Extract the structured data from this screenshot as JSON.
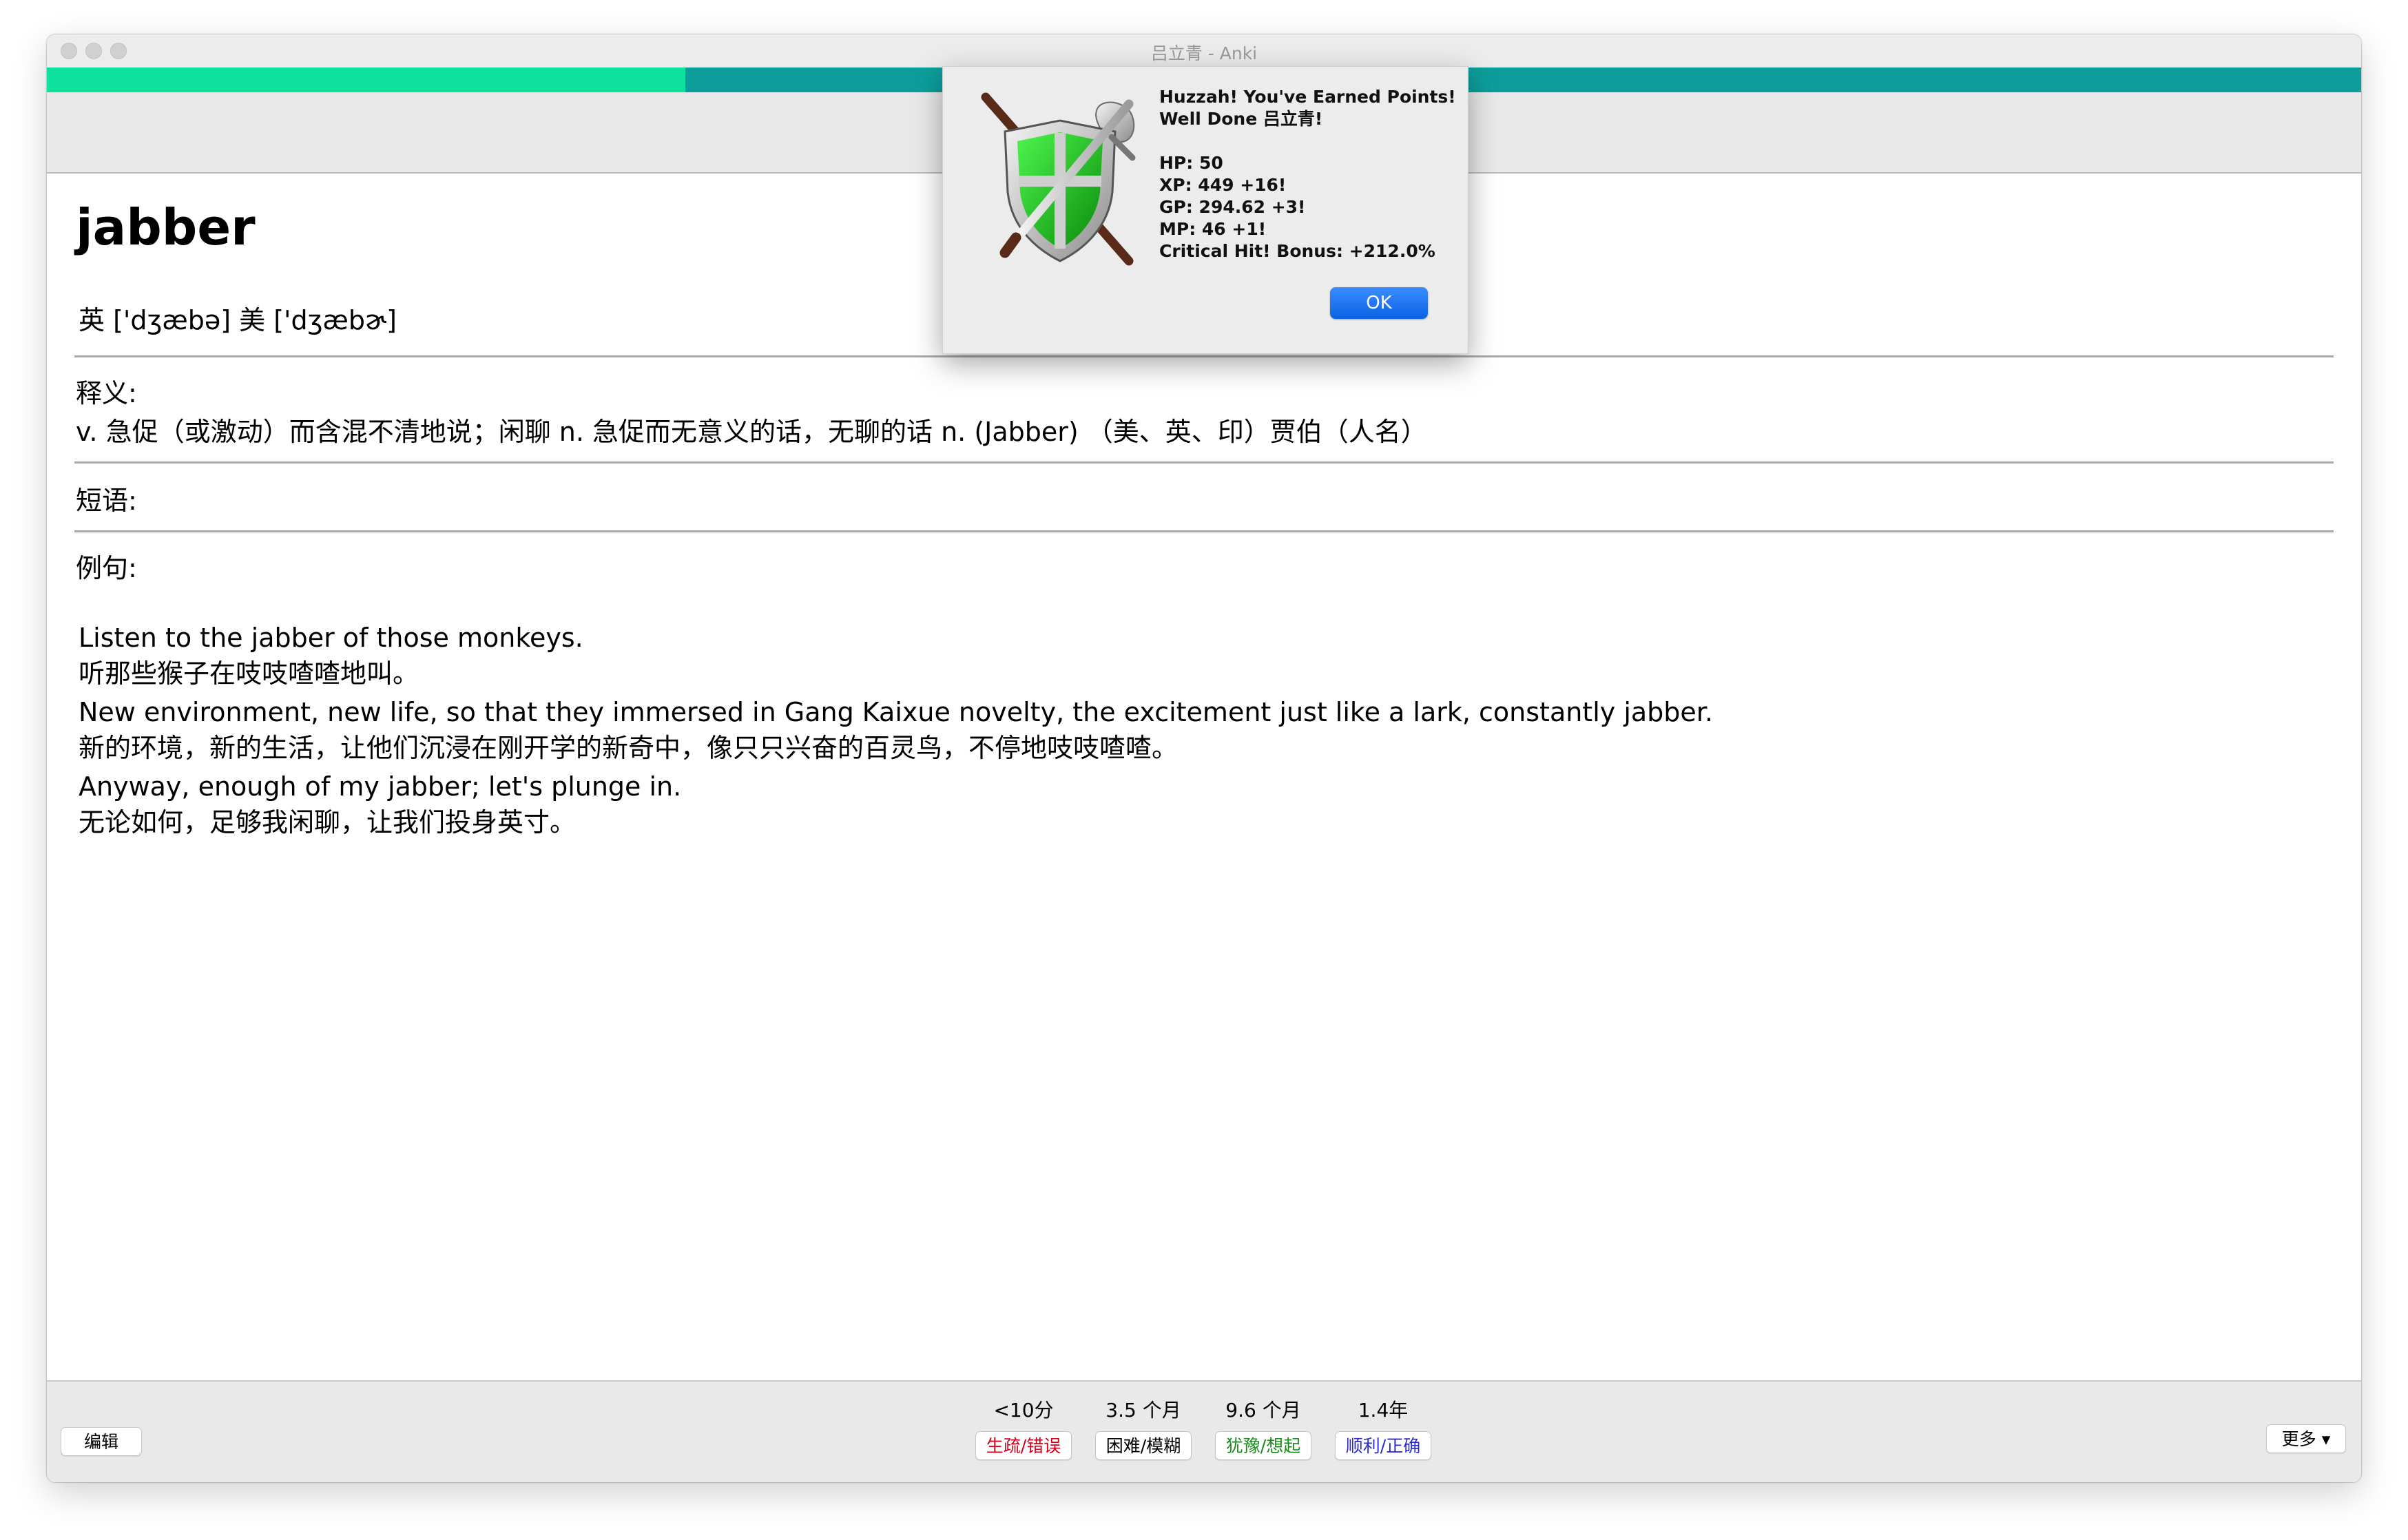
{
  "window": {
    "title": "吕立青 - Anki"
  },
  "progress": {
    "fraction": 0.276
  },
  "card": {
    "word": "jabber",
    "phonetic": "英 ['dʒæbə] 美 ['dʒæbɚ]",
    "definition_label": "释义:",
    "definition": "v. 急促（或激动）而含混不清地说；闲聊 n. 急促而无意义的话，无聊的话 n. (Jabber) （美、英、印）贾伯（人名）",
    "phrases_label": "短语:",
    "examples_label": "例句:",
    "examples": [
      {
        "en": "Listen to the jabber of those monkeys.",
        "zh": "听那些猴子在吱吱喳喳地叫。"
      },
      {
        "en": "New environment, new life, so that they immersed in Gang Kaixue novelty, the excitement just like a lark, constantly jabber.",
        "zh": "新的环境，新的生活，让他们沉浸在刚开学的新奇中，像只只兴奋的百灵鸟，不停地吱吱喳喳。"
      },
      {
        "en": "Anyway, enough of my jabber; let's plunge in.",
        "zh": "无论如何，足够我闲聊，让我们投身英寸。"
      }
    ]
  },
  "bottom": {
    "edit_label": "编辑",
    "more_label": "更多 ▾",
    "answers": [
      {
        "interval": "<10分",
        "label": "生疏/错误",
        "color": "#d0021b"
      },
      {
        "interval": "3.5 个月",
        "label": "困难/模糊",
        "color": "#000000"
      },
      {
        "interval": "9.6 个月",
        "label": "犹豫/想起",
        "color": "#1a8a1a"
      },
      {
        "interval": "1.4年",
        "label": "顺利/正确",
        "color": "#2a2ad0"
      }
    ]
  },
  "dialog": {
    "heading": "Huzzah! You've Earned Points!",
    "greeting": "Well Done 吕立青!",
    "hp": "HP: 50",
    "xp": "XP: 449  +16!",
    "gp": "GP: 294.62  +3!",
    "mp": "MP: 46  +1!",
    "critical": "Critical Hit! Bonus: +212.0%",
    "ok_label": "OK",
    "icon": "shield-crossed-weapons-icon"
  }
}
